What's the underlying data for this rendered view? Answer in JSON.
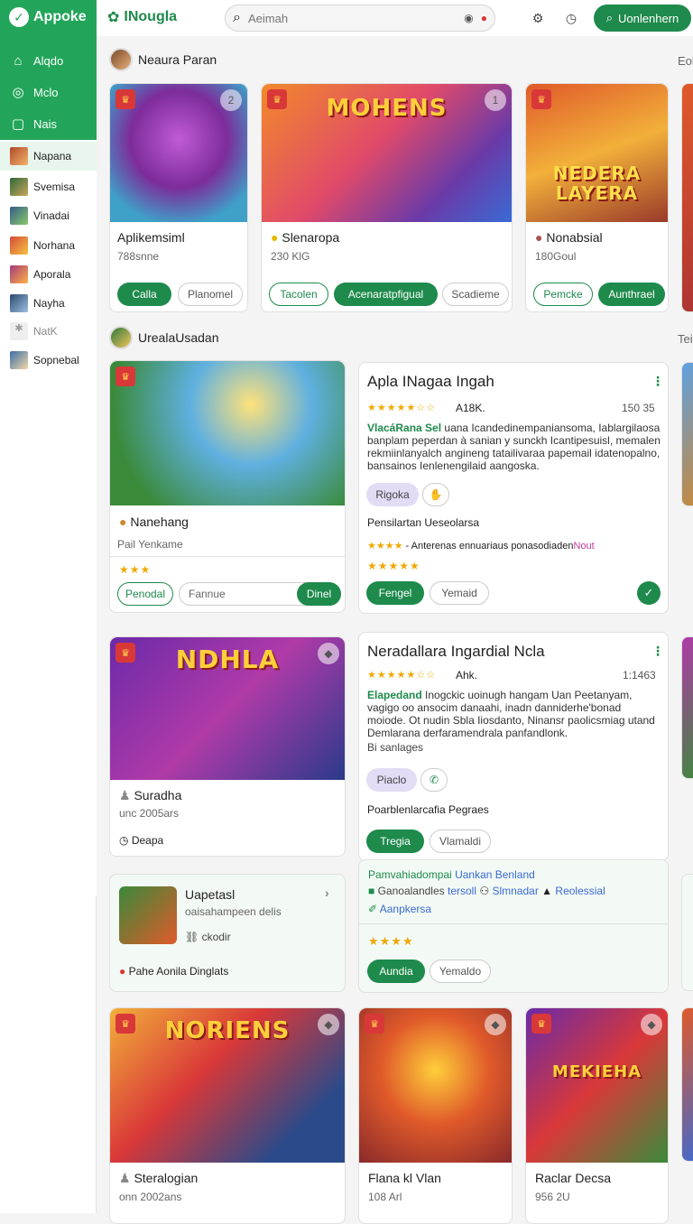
{
  "sidebar": {
    "brand": "Appoke",
    "nav": [
      {
        "label": "Alqdo",
        "icon": "home-icon"
      },
      {
        "label": "Mclo",
        "icon": "radio-icon"
      },
      {
        "label": "Nais",
        "icon": "bag-icon"
      }
    ],
    "items": [
      {
        "label": "Napana"
      },
      {
        "label": "Svemisa"
      },
      {
        "label": "Vinadai"
      },
      {
        "label": "Norhana"
      },
      {
        "label": "Aporala"
      },
      {
        "label": "Nayha"
      },
      {
        "label": "NatK"
      },
      {
        "label": "Sopnebal"
      }
    ]
  },
  "topbar": {
    "title": "INougla",
    "search_placeholder": "Aeimah",
    "cta": "Uonlenhern"
  },
  "sections": {
    "s1": "Neaura Paran",
    "s1_edge": "Eol",
    "s2": "UrealaUsadan",
    "s2_edge": "Tei"
  },
  "row1": [
    {
      "art": "",
      "name": "Aplikemsiml",
      "sub": "788snne",
      "btn1": "Calla",
      "btn2": "Planomel"
    },
    {
      "art": "MOHENS",
      "name": "Slenaropa",
      "sub": "230 KlG",
      "btn1": "Tacolen",
      "btn2": "Acenaratpfigual",
      "btn3": "Scadieme"
    },
    {
      "art": "NEDERA LAYERA",
      "name": "Nonabsial",
      "sub": "180Goul",
      "btn1": "Pemcke",
      "btn2": "Aunthrael"
    }
  ],
  "left1": {
    "name": "Nanehang",
    "sub": "Pail Yenkame",
    "stars": "★★★",
    "btn1": "Penodal",
    "input": "Fannue",
    "btn2": "Dinel"
  },
  "detail1": {
    "title": "Apla INagaa Ingah",
    "stars": "★★★★★☆☆",
    "meta": "A18K.",
    "num": "150 35",
    "desc_b": "VlacáRana Sel",
    "desc": "uana Icandedinempaniansoma, Iablargilaosa banplam peperdan à sanian y sunckh Icantipesuisl, memalen rekmiinlanyalch angineng tatailivaraa papemail idatenopalno, bansainos Ienlenengilaid aangoska.",
    "chip1": "Rigoka",
    "row": "Pensilartan Ueseolarsa",
    "row2_stars": "★★★★",
    "row2": "Anterenas ennuariaus ponasodiaden",
    "row2_hl": "Nout",
    "stars3": "★★★★★",
    "btn1": "Fengel",
    "btn2": "Yemaid"
  },
  "left2": {
    "art": "NDHLA",
    "name": "Suradha",
    "sub": "unc 2005ars",
    "link": "Deapa"
  },
  "detail2": {
    "title": "Neradallara Ingardial Ncla",
    "stars": "★★★★★☆☆",
    "meta": "Ahk.",
    "num": "1:1463",
    "desc_b": "Elapedand",
    "desc": "Inogckic uoinugh hangam Uan Peetanyam, vagigo oo ansocim danaahi, inadn danniderhe'bonad moiode. Ot nudin Sbla Iiosdanto, Ninansr paolicsmiag utand Demlarana derfaramendrala panfandlonk.",
    "foot": "Bi sanlages",
    "chip1": "Piaclo",
    "row": "Poarblenlarcafia Pegraes",
    "btn1": "Tregia",
    "btn2": "Vlamaldi"
  },
  "promo": {
    "name": "Uapetasl",
    "sub": "oaisahampeen delis",
    "meta": "ckodir",
    "loc": "Pahe Aonila Dinglats"
  },
  "promo2": {
    "line1": "Pamvahiadompai",
    "line1b": "Uankan Benland",
    "a": "Ganoalandles",
    "b": "tersoll",
    "c": "Slmnadar",
    "d": "Reolessial",
    "e": "Aanpkersa",
    "stars": "★★★★",
    "btn1": "Aundia",
    "btn2": "Yemaldo"
  },
  "row3": [
    {
      "art": "NORIENS",
      "name": "Steralogian",
      "sub": "onn 2002ans"
    },
    {
      "art": "",
      "name": "Flana kl Vlan",
      "sub": "108 Arl"
    },
    {
      "art": "MEKIEHA",
      "name": "Raclar Decsa",
      "sub": "956 2U"
    }
  ]
}
